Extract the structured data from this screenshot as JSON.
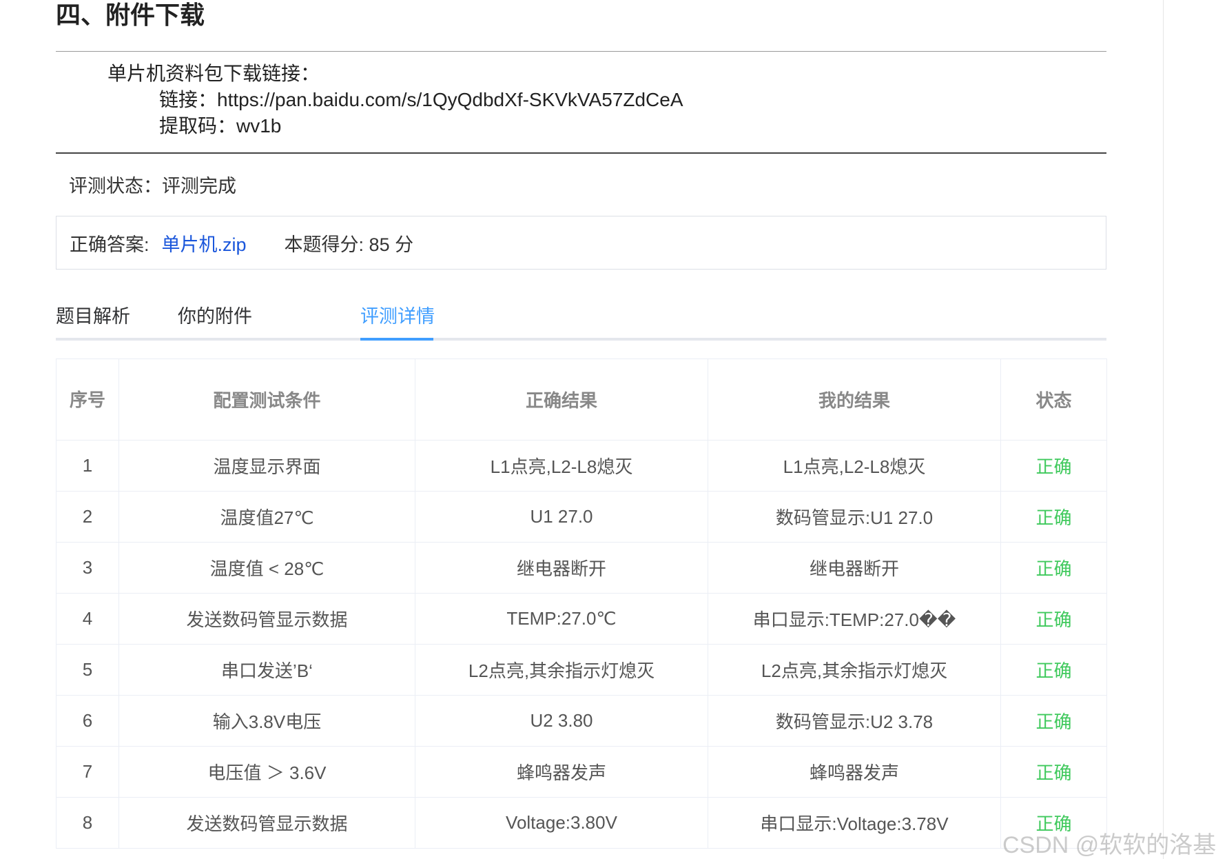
{
  "section": {
    "title": "四、附件下载"
  },
  "download": {
    "intro": "单片机资料包下载链接：",
    "link_line": "链接：https://pan.baidu.com/s/1QyQdbdXf-SKVkVA57ZdCeA",
    "code_line": "提取码：wv1b"
  },
  "status": {
    "label": "评测状态：",
    "value": "评测完成"
  },
  "answer": {
    "label": "正确答案:",
    "file_name": "单片机.zip",
    "score_text": "本题得分: 85 分"
  },
  "tabs": [
    {
      "label": "题目解析",
      "active": false
    },
    {
      "label": "你的附件",
      "active": false
    },
    {
      "label": "评测详情",
      "active": true
    }
  ],
  "table": {
    "headers": [
      "序号",
      "配置测试条件",
      "正确结果",
      "我的结果",
      "状态"
    ],
    "rows": [
      [
        "1",
        "温度显示界面",
        "L1点亮,L2-L8熄灭",
        "L1点亮,L2-L8熄灭",
        "正确"
      ],
      [
        "2",
        "温度值27℃",
        "U1 27.0",
        "数码管显示:U1 27.0",
        "正确"
      ],
      [
        "3",
        "温度值 < 28℃",
        "继电器断开",
        "继电器断开",
        "正确"
      ],
      [
        "4",
        "发送数码管显示数据",
        "TEMP:27.0℃",
        "串口显示:TEMP:27.0��",
        "正确"
      ],
      [
        "5",
        "串口发送’B‘",
        "L2点亮,其余指示灯熄灭",
        "L2点亮,其余指示灯熄灭",
        "正确"
      ],
      [
        "6",
        "输入3.8V电压",
        "U2 3.80",
        "数码管显示:U2 3.78",
        "正确"
      ],
      [
        "7",
        "电压值 ＞ 3.6V",
        "蜂鸣器发声",
        "蜂鸣器发声",
        "正确"
      ],
      [
        "8",
        "发送数码管显示数据",
        "Voltage:3.80V",
        "串口显示:Voltage:3.78V",
        "正确"
      ]
    ]
  },
  "watermark": "CSDN @软软的洛基.",
  "colors": {
    "accent": "#409eff",
    "ok": "#3fc95c",
    "link": "#1a56db"
  }
}
